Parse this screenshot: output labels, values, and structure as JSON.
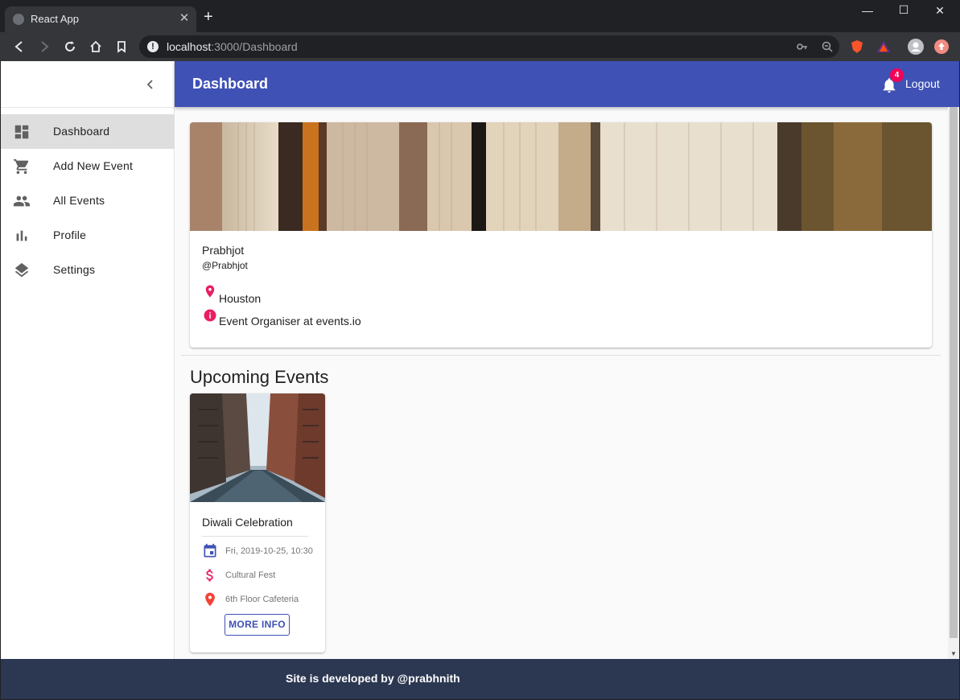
{
  "browser": {
    "tab_title": "React App",
    "url_host": "localhost",
    "url_path": ":3000/Dashboard",
    "new_tab": "+",
    "tab_close": "✕"
  },
  "sidebar": {
    "items": [
      {
        "label": "Dashboard",
        "icon": "dashboard-icon",
        "active": true
      },
      {
        "label": "Add New Event",
        "icon": "cart-icon"
      },
      {
        "label": "All Events",
        "icon": "people-icon"
      },
      {
        "label": "Profile",
        "icon": "bar-chart-icon"
      },
      {
        "label": "Settings",
        "icon": "layers-icon"
      }
    ]
  },
  "appbar": {
    "title": "Dashboard",
    "notification_count": "4",
    "logout_label": "Logout"
  },
  "profile": {
    "name": "Prabhjot",
    "handle": "@Prabhjot",
    "location": "Houston",
    "bio": "Event Organiser at events.io"
  },
  "upcoming": {
    "title": "Upcoming Events",
    "events": [
      {
        "title": "Diwali Celebration",
        "date": "Fri, 2019-10-25, 10:30",
        "category": "Cultural Fest",
        "venue": "6th Floor Cafeteria",
        "button_label": "MORE INFO"
      }
    ]
  },
  "footer": {
    "text": "Site is developed by @prabhnith"
  },
  "colors": {
    "primary": "#3f51b5",
    "accent": "#f50057",
    "footer": "#2c3752"
  }
}
